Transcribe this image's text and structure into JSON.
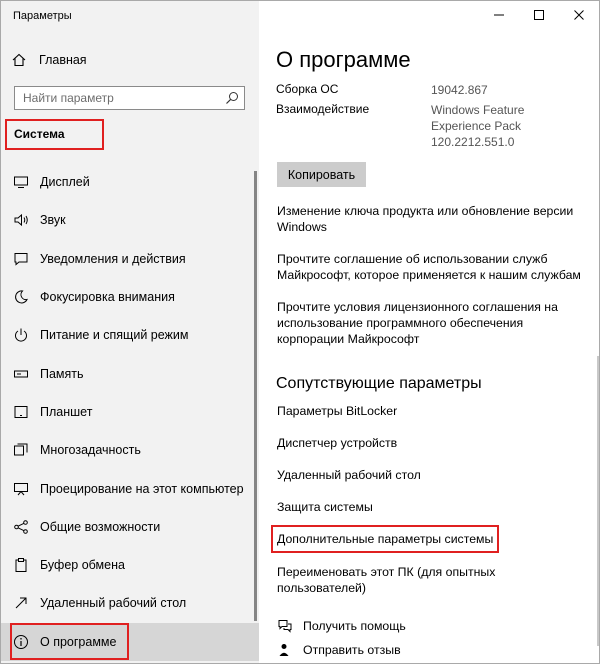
{
  "window": {
    "title": "Параметры"
  },
  "sidebar": {
    "home_label": "Главная",
    "search_placeholder": "Найти параметр",
    "section_label": "Система",
    "items": [
      {
        "label": "Дисплей",
        "icon": "display-icon"
      },
      {
        "label": "Звук",
        "icon": "speaker-icon"
      },
      {
        "label": "Уведомления и действия",
        "icon": "notification-icon"
      },
      {
        "label": "Фокусировка внимания",
        "icon": "moon-icon"
      },
      {
        "label": "Питание и спящий режим",
        "icon": "power-icon"
      },
      {
        "label": "Память",
        "icon": "storage-icon"
      },
      {
        "label": "Планшет",
        "icon": "tablet-icon"
      },
      {
        "label": "Многозадачность",
        "icon": "multitasking-icon"
      },
      {
        "label": "Проецирование на этот компьютер",
        "icon": "projector-icon"
      },
      {
        "label": "Общие возможности",
        "icon": "share-icon"
      },
      {
        "label": "Буфер обмена",
        "icon": "clipboard-icon"
      },
      {
        "label": "Удаленный рабочий стол",
        "icon": "remote-desktop-icon"
      },
      {
        "label": "О программе",
        "icon": "info-icon",
        "active": true
      }
    ]
  },
  "main": {
    "title": "О программе",
    "specs": [
      {
        "label": "Сборка ОС",
        "value_lines": [
          "19042.867"
        ]
      },
      {
        "label": "Взаимодействие",
        "value_lines": [
          "Windows Feature",
          "Experience Pack",
          "120.2212.551.0"
        ]
      }
    ],
    "copy_button": "Копировать",
    "links": [
      {
        "lines": [
          "Изменение ключа продукта или обновление версии",
          "Windows"
        ]
      },
      {
        "lines": [
          "Прочтите соглашение об использовании служб",
          "Майкрософт, которое применяется к нашим службам"
        ]
      },
      {
        "lines": [
          "Прочтите условия лицензионного соглашения на",
          "использование программного обеспечения",
          "корпорации Майкрософт"
        ]
      }
    ],
    "related_heading": "Сопутствующие параметры",
    "related_links": [
      "Параметры BitLocker",
      "Диспетчер устройств",
      "Удаленный рабочий стол",
      "Защита системы",
      "Дополнительные параметры системы",
      "Переименовать этот ПК (для опытных пользователей)"
    ],
    "help": [
      {
        "label": "Получить помощь",
        "icon": "help-chat-icon"
      },
      {
        "label": "Отправить отзыв",
        "icon": "feedback-icon"
      }
    ]
  },
  "colors": {
    "highlight_box": "#e02020",
    "sidebar_bg": "#f2f2f2",
    "active_item_bg": "#d6d6d6",
    "button_bg": "#cccccc"
  }
}
